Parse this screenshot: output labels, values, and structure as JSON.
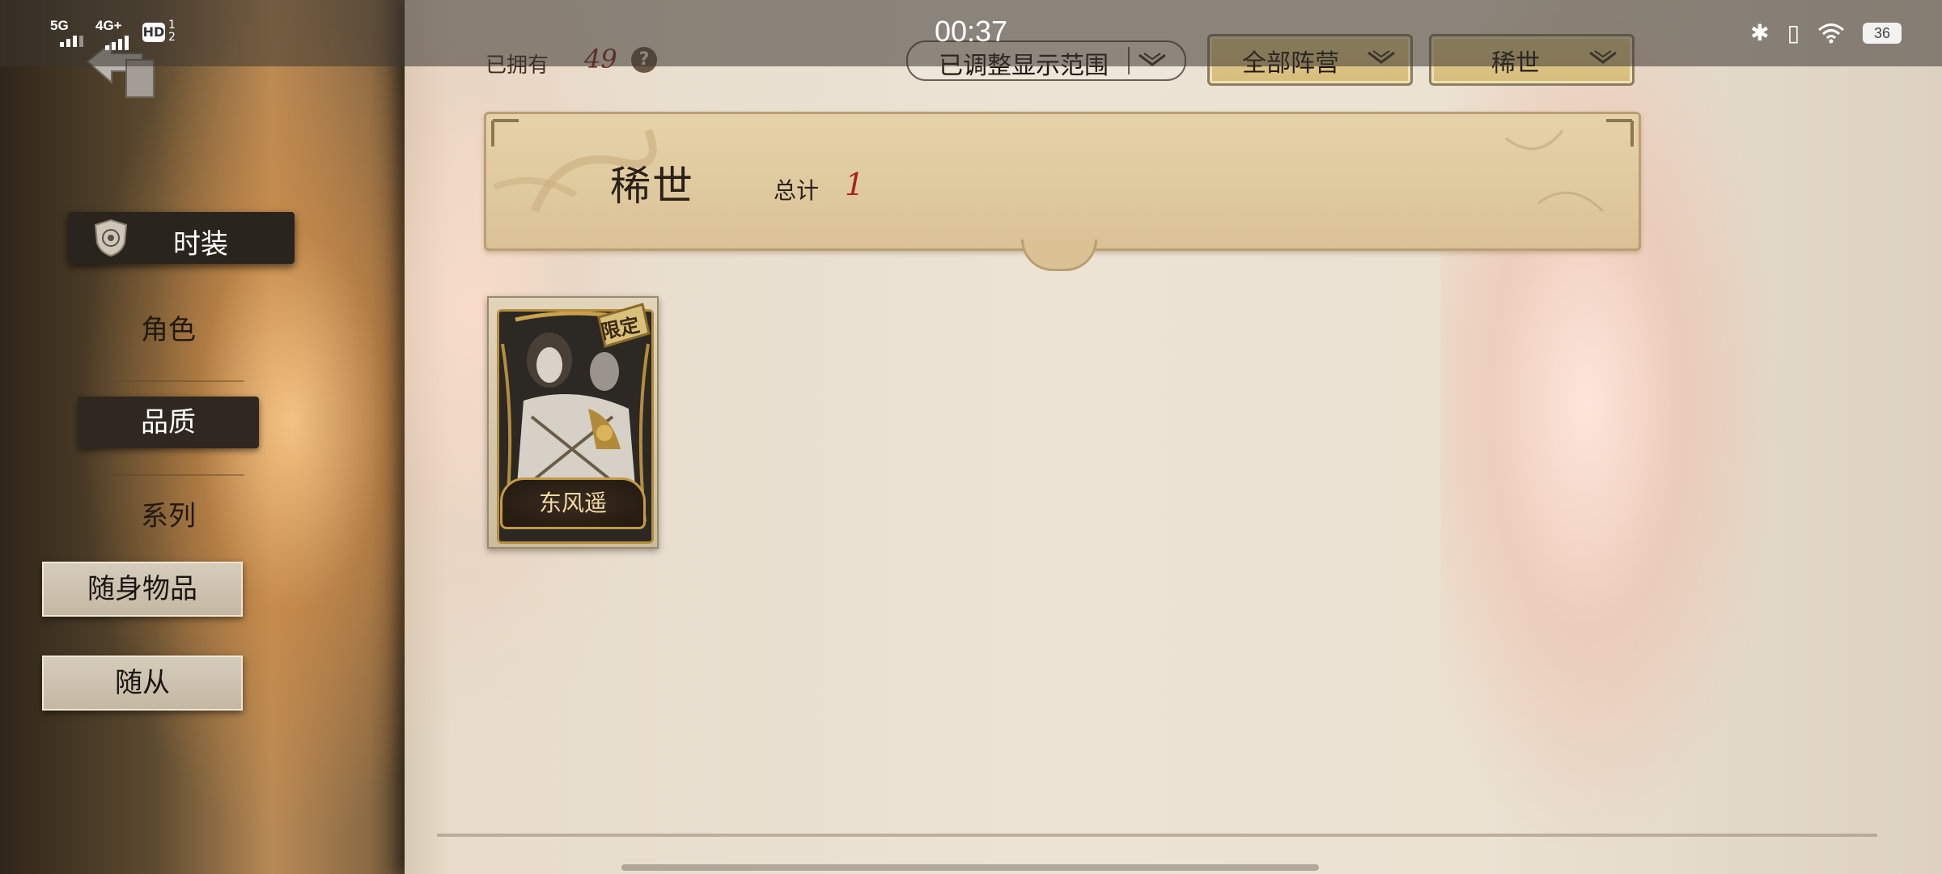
{
  "status_bar": {
    "time": "00:37",
    "signal_1": "5G",
    "signal_2": "4G+",
    "hd_label": "HD",
    "hd_sub_1": "1",
    "hd_sub_2": "2",
    "battery": "36"
  },
  "sidebar": {
    "main_tab": "时装",
    "sub_items": [
      "角色",
      "品质",
      "系列"
    ],
    "active_sub_index": 1,
    "other_tabs": [
      "随身物品",
      "随从"
    ]
  },
  "top_bar": {
    "owned_label": "已拥有",
    "owned_value": "49",
    "help_icon": "?",
    "range_dropdown": "已调整显示范围",
    "faction_select": "全部阵营",
    "quality_select": "稀世"
  },
  "banner": {
    "title": "稀世",
    "total_label": "总计",
    "total_value": "1"
  },
  "items": [
    {
      "name": "东风遥",
      "badge": "限定"
    }
  ],
  "colors": {
    "accent_red": "#a2271f",
    "gold": "#c49a45",
    "dark_tab": "#2a241e"
  }
}
